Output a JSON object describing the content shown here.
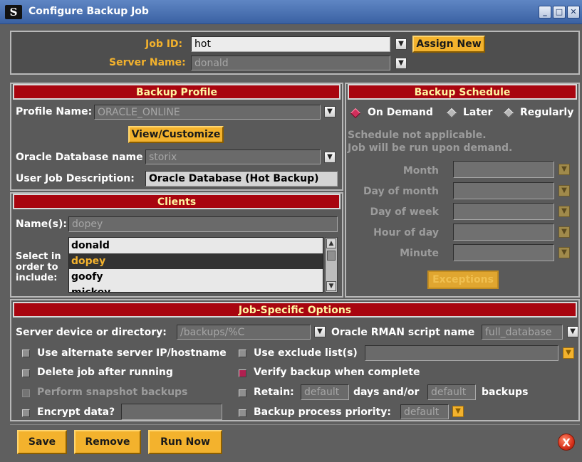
{
  "window": {
    "title": "Configure Backup Job",
    "logo_text": "S",
    "min_glyph": "_",
    "max_glyph": "□",
    "close_glyph": "✕"
  },
  "job": {
    "id_label": "Job ID:",
    "id_value": "hot",
    "assign_new_label": "Assign New",
    "server_label": "Server Name:",
    "server_value": "donald"
  },
  "profile": {
    "header": "Backup Profile",
    "name_label": "Profile Name:",
    "name_value": "ORACLE_ONLINE",
    "view_customize_label": "View/Customize",
    "db_label": "Oracle Database name",
    "db_value": "storix",
    "desc_label": "User Job Description:",
    "desc_value": "Oracle Database (Hot Backup)"
  },
  "schedule": {
    "header": "Backup Schedule",
    "options": [
      "On Demand",
      "Later",
      "Regularly"
    ],
    "selected": "On Demand",
    "note_line1": "Schedule not applicable.",
    "note_line2": "Job will be run upon demand.",
    "fields": [
      "Month",
      "Day of month",
      "Day of week",
      "Hour of day",
      "Minute"
    ],
    "exceptions_label": "Exceptions"
  },
  "clients": {
    "header": "Clients",
    "names_label": "Name(s):",
    "names_value": "dopey",
    "select_label_lines": [
      "Select in",
      "order to",
      "include:"
    ],
    "list": [
      "donald",
      "dopey",
      "goofy",
      "mickey"
    ],
    "selected": "dopey"
  },
  "options": {
    "header": "Job-Specific Options",
    "server_device_label": "Server device or directory:",
    "server_device_value": "/backups/%C",
    "rman_label": "Oracle RMAN script name",
    "rman_value": "full_database",
    "alt_ip_label": "Use alternate server IP/hostname",
    "exclude_label": "Use exclude list(s)",
    "delete_label": "Delete job after running",
    "verify_label": "Verify backup when complete",
    "snapshot_label": "Perform snapshot backups",
    "retain_label": "Retain:",
    "retain_days_value": "default",
    "retain_days_suffix": "days and/or",
    "retain_backups_value": "default",
    "retain_backups_suffix": "backups",
    "encrypt_label": "Encrypt data?",
    "priority_label": "Backup process priority:",
    "priority_value": "default"
  },
  "footer": {
    "save_label": "Save",
    "remove_label": "Remove",
    "run_now_label": "Run Now",
    "close_glyph": "X"
  },
  "colors": {
    "accent": "#f3b22d",
    "header_bg": "#a8050f",
    "background": "#5f5f5f",
    "titlebar": "#3a61a3"
  },
  "icons": {
    "dropdown": "chevron-down-icon",
    "close": "close-circle-icon"
  }
}
